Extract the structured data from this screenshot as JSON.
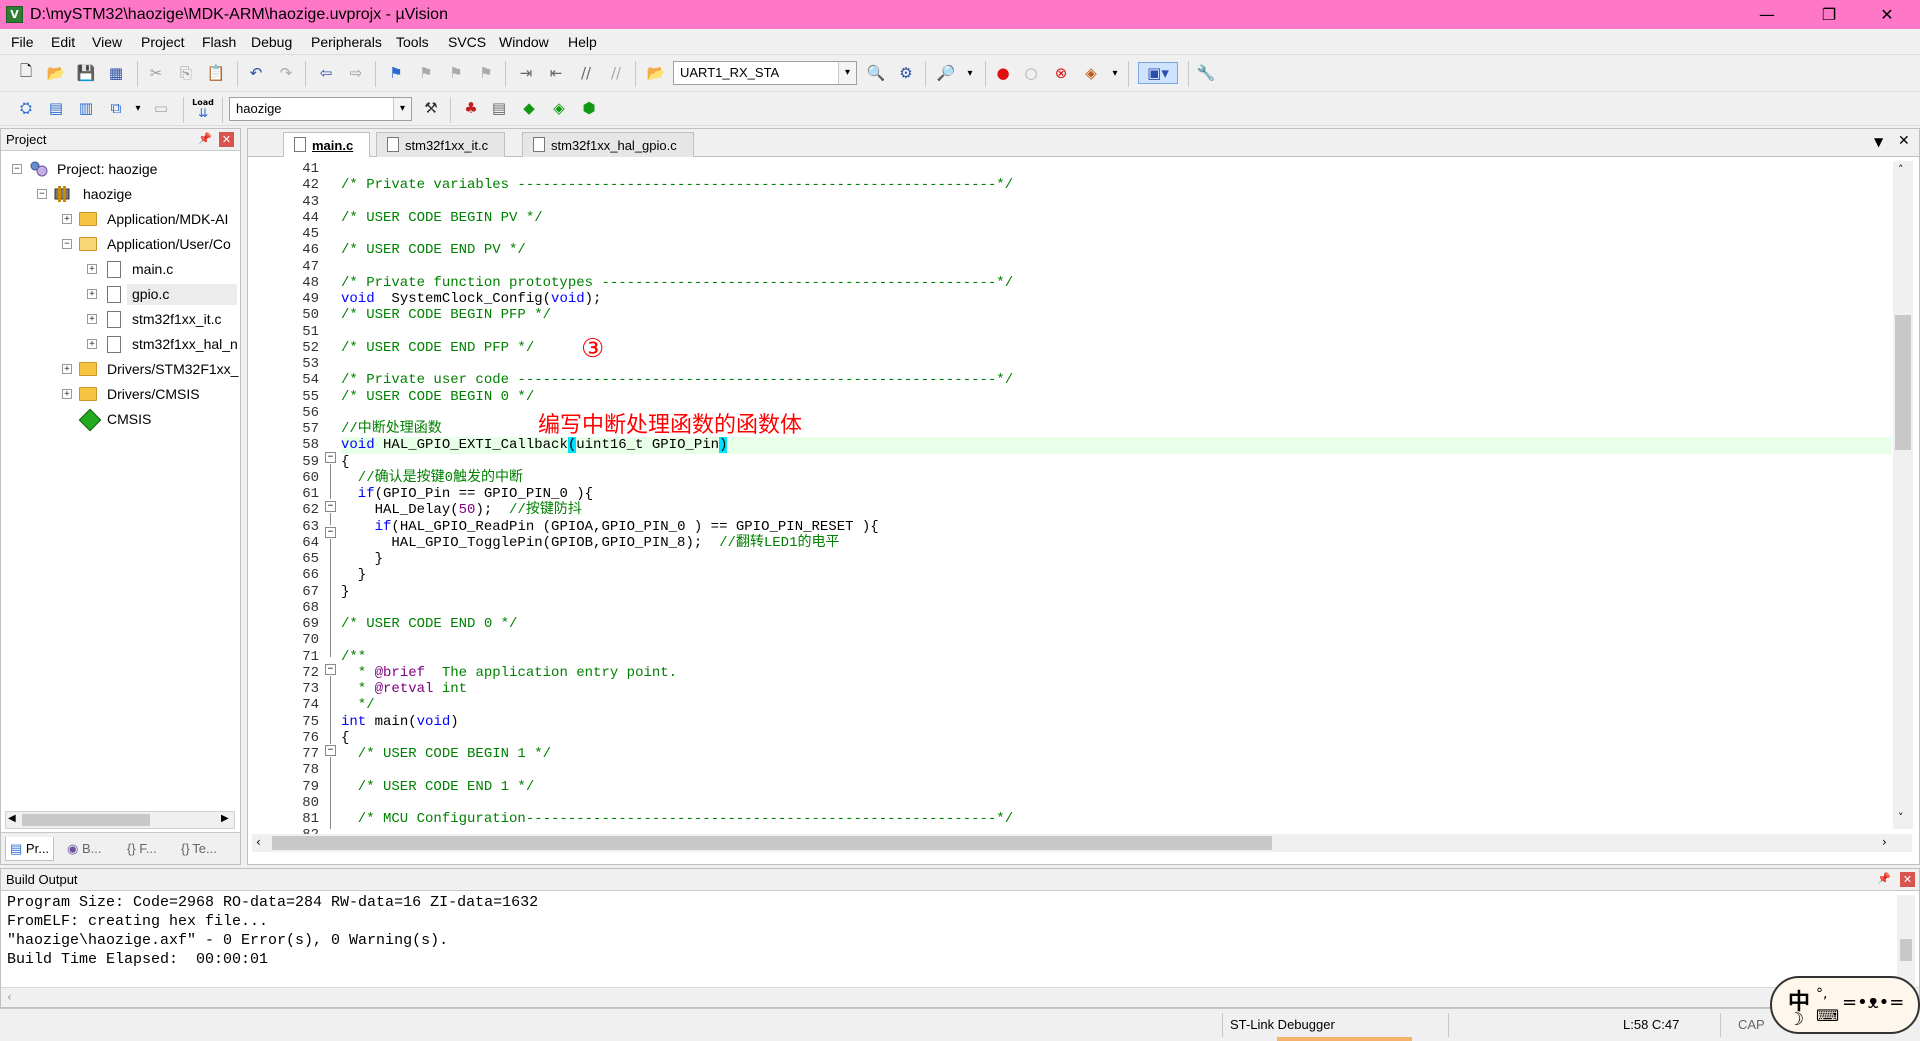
{
  "window": {
    "title": "D:\\mySTM32\\haozige\\MDK-ARM\\haozige.uvprojx - µVision",
    "minimize": "—",
    "restore": "❐",
    "close": "✕"
  },
  "menu": [
    "File",
    "Edit",
    "View",
    "Project",
    "Flash",
    "Debug",
    "Peripherals",
    "Tools",
    "SVCS",
    "Window",
    "Help"
  ],
  "toolbar1": {
    "find_combo": "UART1_RX_STA"
  },
  "toolbar2": {
    "target_combo": "haozige",
    "load_label": "Load"
  },
  "project_panel": {
    "title": "Project",
    "root": "Project: haozige",
    "target": "haozige",
    "groups": [
      {
        "name": "Application/MDK-AI",
        "expanded": false
      },
      {
        "name": "Application/User/Co",
        "expanded": true,
        "files": [
          "main.c",
          "gpio.c",
          "stm32f1xx_it.c",
          "stm32f1xx_hal_n"
        ]
      },
      {
        "name": "Drivers/STM32F1xx_",
        "expanded": false
      },
      {
        "name": "Drivers/CMSIS",
        "expanded": false
      }
    ],
    "cmsis": "CMSIS",
    "tabs": [
      "Pr...",
      "B...",
      "{} F...",
      "{} Te..."
    ]
  },
  "editor": {
    "tabs": [
      "main.c",
      "stm32f1xx_it.c",
      "stm32f1xx_hal_gpio.c"
    ],
    "active_tab": "main.c",
    "first_line": 41,
    "current_line": 58
  },
  "annotations": {
    "step": "③",
    "note": "编写中断处理函数的函数体"
  },
  "build_output": {
    "title": "Build Output",
    "lines": [
      "Program Size: Code=2968 RO-data=284 RW-data=16 ZI-data=1632",
      "FromELF: creating hex file...",
      "\"haozige\\haozige.axf\" - 0 Error(s), 0 Warning(s).",
      "Build Time Elapsed:  00:00:01"
    ]
  },
  "status": {
    "debugger": "ST-Link Debugger",
    "position": "L:58 C:47",
    "cap": "CAP"
  },
  "ime": {
    "label": "中"
  }
}
